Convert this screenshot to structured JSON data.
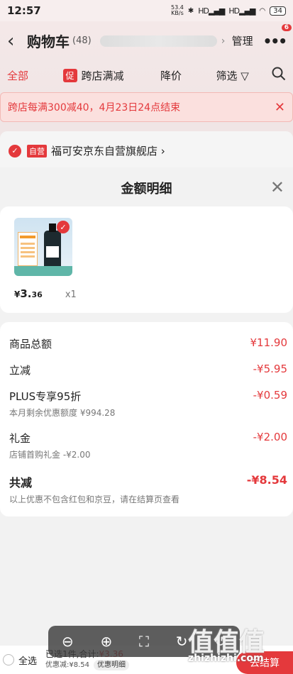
{
  "status": {
    "time": "12:57",
    "net_speed": "53.4",
    "net_unit": "KB/s",
    "signals": [
      "HD",
      "HD"
    ],
    "battery": "34"
  },
  "header": {
    "title": "购物车",
    "count": "(48)",
    "manage": "管理",
    "badge": "6"
  },
  "tabs": {
    "all": "全部",
    "promo_tag": "促",
    "promo": "跨店满减",
    "price": "降价",
    "filter": "筛选"
  },
  "banner": {
    "text": "跨店每满300减40，4月23日24点结束"
  },
  "shop": {
    "tag": "自营",
    "name": "福可安京东自营旗舰店"
  },
  "sheet": {
    "title": "金额明细",
    "product": {
      "price_symbol": "¥",
      "price_int": "3.",
      "price_dec": "36",
      "qty": "x1"
    },
    "lines": {
      "total_label": "商品总额",
      "total_amount": "¥11.90",
      "direct_label": "立减",
      "direct_amount": "-¥5.95",
      "plus_label": "PLUS专享95折",
      "plus_amount": "-¥0.59",
      "plus_sub": "本月剩余优惠额度 ¥994.28",
      "gift_label": "礼金",
      "gift_amount": "-¥2.00",
      "gift_sub": "店铺首购礼金 -¥2.00",
      "sum_label": "共减",
      "sum_amount": "-¥8.54",
      "sum_sub": "以上优惠不包含红包和京豆，请在结算页查看"
    }
  },
  "bottom": {
    "select_all": "全选",
    "selected": "已选1件,合计:",
    "total": "¥3.36",
    "saved": "优惠减:¥8.54",
    "detail_pill": "优惠明细",
    "checkout": "去结算"
  },
  "watermark": {
    "text": "值值值",
    "url": "zhizhizhi.com"
  }
}
